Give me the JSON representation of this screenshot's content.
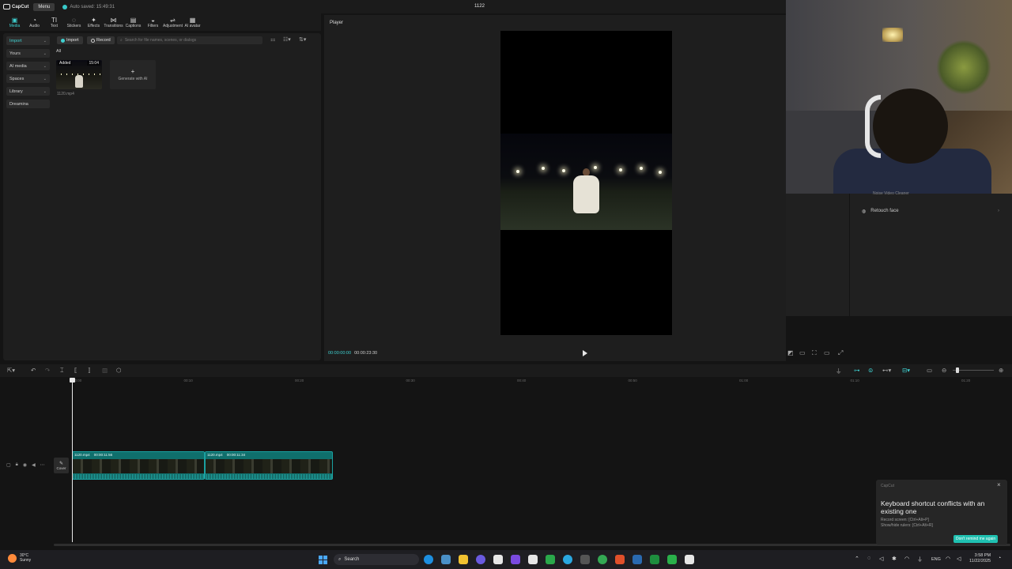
{
  "titlebar": {
    "logo": "CapCut",
    "menu": "Menu",
    "autosave": "Auto saved: 15:49:31",
    "project_title": "1122"
  },
  "toolbar": {
    "tools": [
      {
        "label": "Media",
        "icon": "media-icon",
        "glyph": "▣"
      },
      {
        "label": "Audio",
        "icon": "audio-icon",
        "glyph": "◔"
      },
      {
        "label": "Text",
        "icon": "text-icon",
        "glyph": "TI"
      },
      {
        "label": "Stickers",
        "icon": "stickers-icon",
        "glyph": "◌"
      },
      {
        "label": "Effects",
        "icon": "effects-icon",
        "glyph": "✦"
      },
      {
        "label": "Transitions",
        "icon": "transitions-icon",
        "glyph": "⋈"
      },
      {
        "label": "Captions",
        "icon": "captions-icon",
        "glyph": "▤"
      },
      {
        "label": "Filters",
        "icon": "filters-icon",
        "glyph": "◒"
      },
      {
        "label": "Adjustment",
        "icon": "adjustment-icon",
        "glyph": "⇌"
      },
      {
        "label": "AI avatar",
        "icon": "ai-avatar-icon",
        "glyph": "▦"
      }
    ]
  },
  "sidebar": {
    "items": [
      {
        "label": "Import",
        "active": true,
        "chevron": true
      },
      {
        "label": "Yours",
        "active": false,
        "chevron": true
      },
      {
        "label": "AI media",
        "active": false,
        "chevron": true
      },
      {
        "label": "Spaces",
        "active": false,
        "chevron": true
      },
      {
        "label": "Library",
        "active": false,
        "chevron": true
      },
      {
        "label": "Dreamina",
        "active": false,
        "chevron": false
      }
    ]
  },
  "media": {
    "import_label": "Import",
    "record_label": "Record",
    "search_placeholder": "Search for file names, scenes, or dialogs",
    "filter_all": "All",
    "tile": {
      "badge_left": "Added",
      "badge_right": "15:04",
      "filename": "1120.mp4"
    },
    "generate_label": "Generate with AI",
    "generate_glyph": "+"
  },
  "player": {
    "label": "Player",
    "current_time": "00:00:00:00",
    "total_time": "00:00:23:30"
  },
  "right_panel": {
    "prev_item": "Noise Video Cleaner",
    "retouch_label": "Retouch face"
  },
  "timeline": {
    "ticks": [
      "00:00",
      "00:10",
      "00:20",
      "00:30",
      "00:40",
      "00:50",
      "01:00",
      "01:10",
      "01:20"
    ],
    "cover_label": "Cover",
    "clips": [
      {
        "name": "1120.mp4",
        "duration": "00:00:11:56"
      },
      {
        "name": "1120.mp4",
        "duration": "00:00:11:34"
      }
    ]
  },
  "toast": {
    "app": "CapCut",
    "title": "Keyboard shortcut conflicts with an existing one",
    "line1": "Record screen: [Ctrl+Alt+P]",
    "line2": "Show/hide rulers: [Ctrl+Alt+R]",
    "button": "Don't remind me again",
    "close": "×"
  },
  "taskbar": {
    "temp": "30°C",
    "weather": "Sunny",
    "search": "Search",
    "lang": "ENG",
    "time": "3:58 PM",
    "date": "11/22/2025"
  },
  "colors": {
    "accent": "#3fd0d0",
    "clip": "#0f6f6c",
    "toast_button": "#1fc0b0"
  }
}
